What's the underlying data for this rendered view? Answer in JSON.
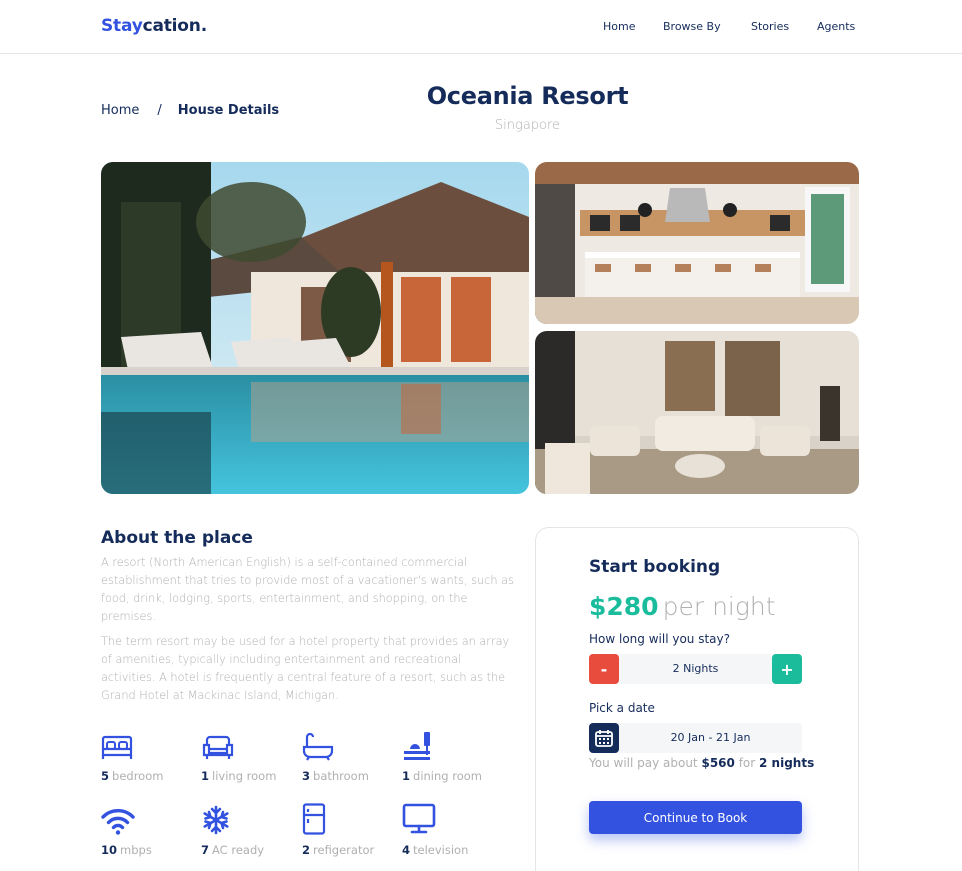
{
  "brand": {
    "accent": "Stay",
    "rest": "cation."
  },
  "nav": {
    "home": "Home",
    "browse": "Browse By",
    "stories": "Stories",
    "agents": "Agents"
  },
  "breadcrumb": {
    "home": "Home",
    "separator": "/",
    "current": "House Details"
  },
  "property": {
    "name": "Oceania Resort",
    "location": "Singapore"
  },
  "about": {
    "title": "About the place",
    "p1": "A resort (North American English) is a self-contained commercial establishment that tries to provide most of a vacationer's wants, such as food, drink, lodging, sports, entertainment, and shopping, on the premises.",
    "p2": "The term resort may be used for a hotel property that provides an array of amenities, typically including entertainment and recreational activities. A hotel is frequently a central feature of a resort, such as the Grand Hotel at Mackinac Island, Michigan."
  },
  "features": [
    {
      "icon": "bed-icon",
      "count": "5",
      "label": "bedroom"
    },
    {
      "icon": "sofa-icon",
      "count": "1",
      "label": "living room"
    },
    {
      "icon": "bathtub-icon",
      "count": "3",
      "label": "bathroom"
    },
    {
      "icon": "dining-icon",
      "count": "1",
      "label": "dining room"
    },
    {
      "icon": "wifi-icon",
      "count": "10",
      "label": "mbps"
    },
    {
      "icon": "snowflake-icon",
      "count": "7",
      "label": "AC ready"
    },
    {
      "icon": "fridge-icon",
      "count": "2",
      "label": "refigerator"
    },
    {
      "icon": "monitor-icon",
      "count": "4",
      "label": "television"
    }
  ],
  "booking": {
    "title": "Start booking",
    "price": "$280",
    "unit": "per night",
    "duration_label": "How long will you stay?",
    "minus": "-",
    "plus": "+",
    "nights": "2 Nights",
    "date_label": "Pick a date",
    "date_range": "20 Jan - 21 Jan",
    "pay_prefix": "You will pay about",
    "pay_total": "$560",
    "pay_for": "for",
    "pay_nights": "2 nights",
    "cta": "Continue to Book"
  },
  "colors": {
    "primary": "#3252df",
    "navy": "#152c5b",
    "teal": "#1abc9c",
    "red": "#e74c3c",
    "gray": "#b0b0b0"
  }
}
